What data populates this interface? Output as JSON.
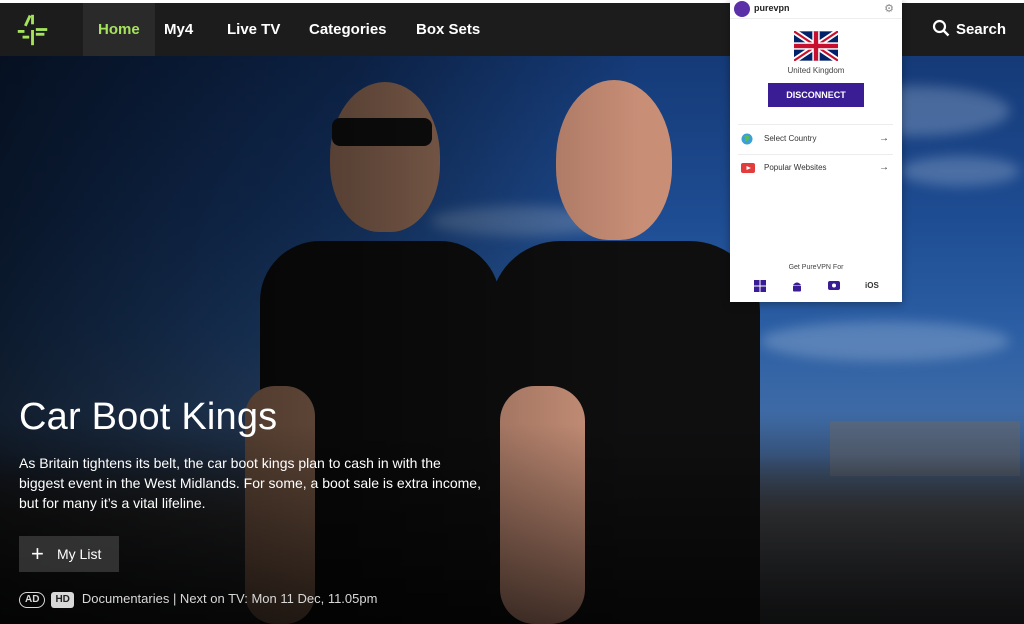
{
  "nav": {
    "items": [
      {
        "label": "Home"
      },
      {
        "label": "My4"
      },
      {
        "label": "Live TV"
      },
      {
        "label": "Categories"
      },
      {
        "label": "Box Sets"
      }
    ],
    "search_label": "Search",
    "accent_color": "#a6e35c"
  },
  "hero": {
    "title": "Car Boot Kings",
    "description": "As Britain tightens its belt, the car boot kings plan to cash in with the biggest event in the West Midlands. For some, a boot sale is extra income, but for many it’s a vital lifeline.",
    "my_list_label": "My List",
    "badge_ad": "AD",
    "badge_hd": "HD",
    "meta": "Documentaries | Next on TV: Mon 11 Dec, 11.05pm"
  },
  "vpn": {
    "brand": "purevpn",
    "country": "United Kingdom",
    "disconnect_label": "DISCONNECT",
    "rows": [
      {
        "label": "Select Country",
        "icon": "globe-icon"
      },
      {
        "label": "Popular Websites",
        "icon": "youtube-icon"
      }
    ],
    "get_label": "Get PureVPN For",
    "ios_label": "iOS",
    "accent_color": "#3a1d95"
  }
}
